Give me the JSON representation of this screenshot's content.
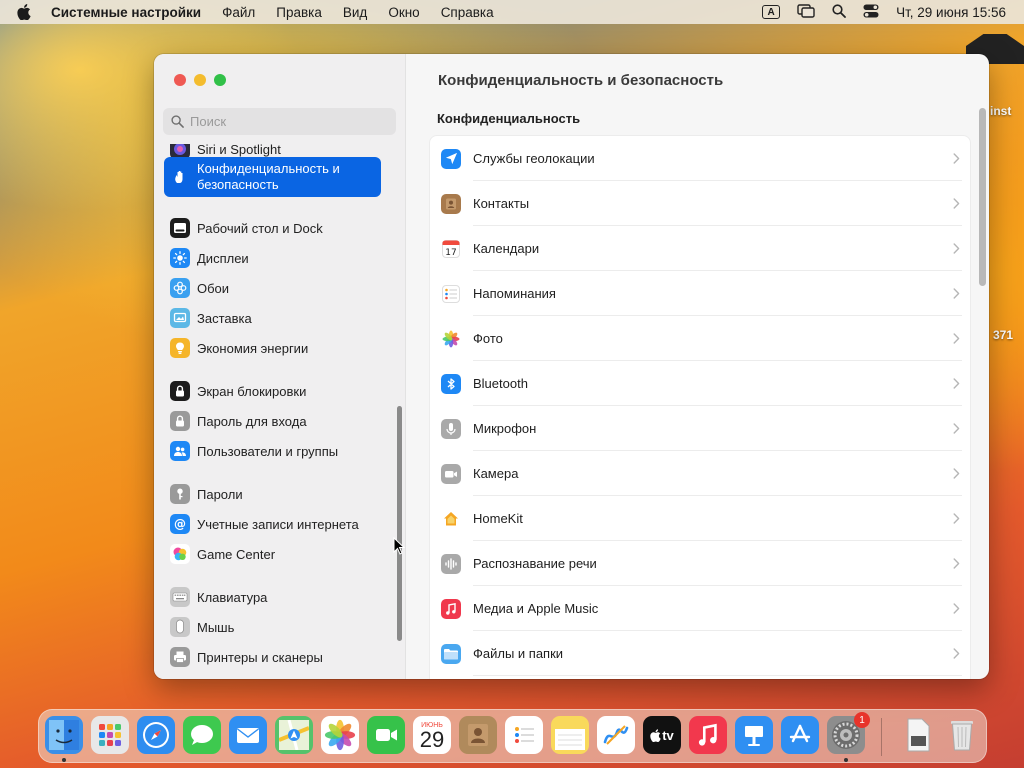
{
  "menubar": {
    "app": "Системные настройки",
    "items": [
      "Файл",
      "Правка",
      "Вид",
      "Окно",
      "Справка"
    ],
    "input_indicator": "A",
    "datetime": "Чт, 29 июня  15:56"
  },
  "desktop": {
    "label1": "inst",
    "label2": "371"
  },
  "sidebar": {
    "search_placeholder": "Поиск",
    "items": [
      {
        "label": "Siri и Spotlight",
        "icon": "siri-icon",
        "color": "#2a2a3a"
      },
      {
        "label": "Конфиденциальность и безопасность",
        "icon": "hand-icon",
        "color": "#0a65e3",
        "active": true
      },
      {
        "label": "Рабочий стол и Dock",
        "icon": "dock-icon",
        "color": "#1c1c1c"
      },
      {
        "label": "Дисплеи",
        "icon": "sun-icon",
        "color": "#1e88f5"
      },
      {
        "label": "Обои",
        "icon": "flower-icon",
        "color": "#3aa0f0"
      },
      {
        "label": "Заставка",
        "icon": "screensaver-icon",
        "color": "#5cb8e6"
      },
      {
        "label": "Экономия энергии",
        "icon": "bulb-icon",
        "color": "#f5b52a"
      },
      {
        "label": "Экран блокировки",
        "icon": "lock-icon",
        "color": "#1c1c1c"
      },
      {
        "label": "Пароль для входа",
        "icon": "padlock-icon",
        "color": "#9a9a9a"
      },
      {
        "label": "Пользователи и группы",
        "icon": "users-icon",
        "color": "#1e88f5"
      },
      {
        "label": "Пароли",
        "icon": "key-icon",
        "color": "#9a9a9a"
      },
      {
        "label": "Учетные записи интернета",
        "icon": "at-icon",
        "color": "#1e88f5"
      },
      {
        "label": "Game Center",
        "icon": "gamecenter-icon",
        "color": "#ffffff"
      },
      {
        "label": "Клавиатура",
        "icon": "keyboard-icon",
        "color": "#c8c8c8"
      },
      {
        "label": "Мышь",
        "icon": "mouse-icon",
        "color": "#c8c8c8"
      },
      {
        "label": "Принтеры и сканеры",
        "icon": "printer-icon",
        "color": "#9a9a9a"
      }
    ]
  },
  "main": {
    "title": "Конфиденциальность и безопасность",
    "section": "Конфиденциальность",
    "rows": [
      {
        "label": "Службы геолокации",
        "icon": "location-icon",
        "color": "#1e88f5"
      },
      {
        "label": "Контакты",
        "icon": "contacts-icon",
        "color": "#a87a4c"
      },
      {
        "label": "Календари",
        "icon": "calendar-icon",
        "color": "#ffffff",
        "glyph": "17"
      },
      {
        "label": "Напоминания",
        "icon": "reminders-icon",
        "color": "#ffffff"
      },
      {
        "label": "Фото",
        "icon": "photos-icon",
        "color": "#ffffff"
      },
      {
        "label": "Bluetooth",
        "icon": "bluetooth-icon",
        "color": "#1e88f5"
      },
      {
        "label": "Микрофон",
        "icon": "microphone-icon",
        "color": "#a9a9a9"
      },
      {
        "label": "Камера",
        "icon": "camera-icon",
        "color": "#a9a9a9"
      },
      {
        "label": "HomeKit",
        "icon": "home-icon",
        "color": "#ffffff"
      },
      {
        "label": "Распознавание речи",
        "icon": "speech-icon",
        "color": "#a9a9a9"
      },
      {
        "label": "Медиа и Apple Music",
        "icon": "music-icon",
        "color": "#f0384d"
      },
      {
        "label": "Файлы и папки",
        "icon": "folder-icon",
        "color": "#4aa8f0"
      }
    ]
  },
  "dock": {
    "calendar_month": "ИЮНЬ",
    "calendar_day": "29",
    "settings_badge": "1",
    "tv_label": "tv",
    "apps": [
      {
        "name": "finder",
        "color": "#3a8fe8"
      },
      {
        "name": "launchpad",
        "color": "#e8e8e8"
      },
      {
        "name": "safari",
        "color": "#2e8df0"
      },
      {
        "name": "messages",
        "color": "#3ec94f"
      },
      {
        "name": "mail",
        "color": "#2f8ff2"
      },
      {
        "name": "maps",
        "color": "#56c26b"
      },
      {
        "name": "photos",
        "color": "#ffffff"
      },
      {
        "name": "facetime",
        "color": "#36c24a"
      },
      {
        "name": "calendar",
        "color": "#ffffff"
      },
      {
        "name": "contacts",
        "color": "#b08a5c"
      },
      {
        "name": "reminders",
        "color": "#ffffff"
      },
      {
        "name": "notes",
        "color": "#f9d95b"
      },
      {
        "name": "freeform",
        "color": "#ffffff"
      },
      {
        "name": "tv",
        "color": "#111111"
      },
      {
        "name": "music",
        "color": "#f2384d"
      },
      {
        "name": "keynote",
        "color": "#2f8ff2"
      },
      {
        "name": "appstore",
        "color": "#2f8ff2"
      },
      {
        "name": "system-settings",
        "color": "#8d8d8d"
      }
    ]
  }
}
